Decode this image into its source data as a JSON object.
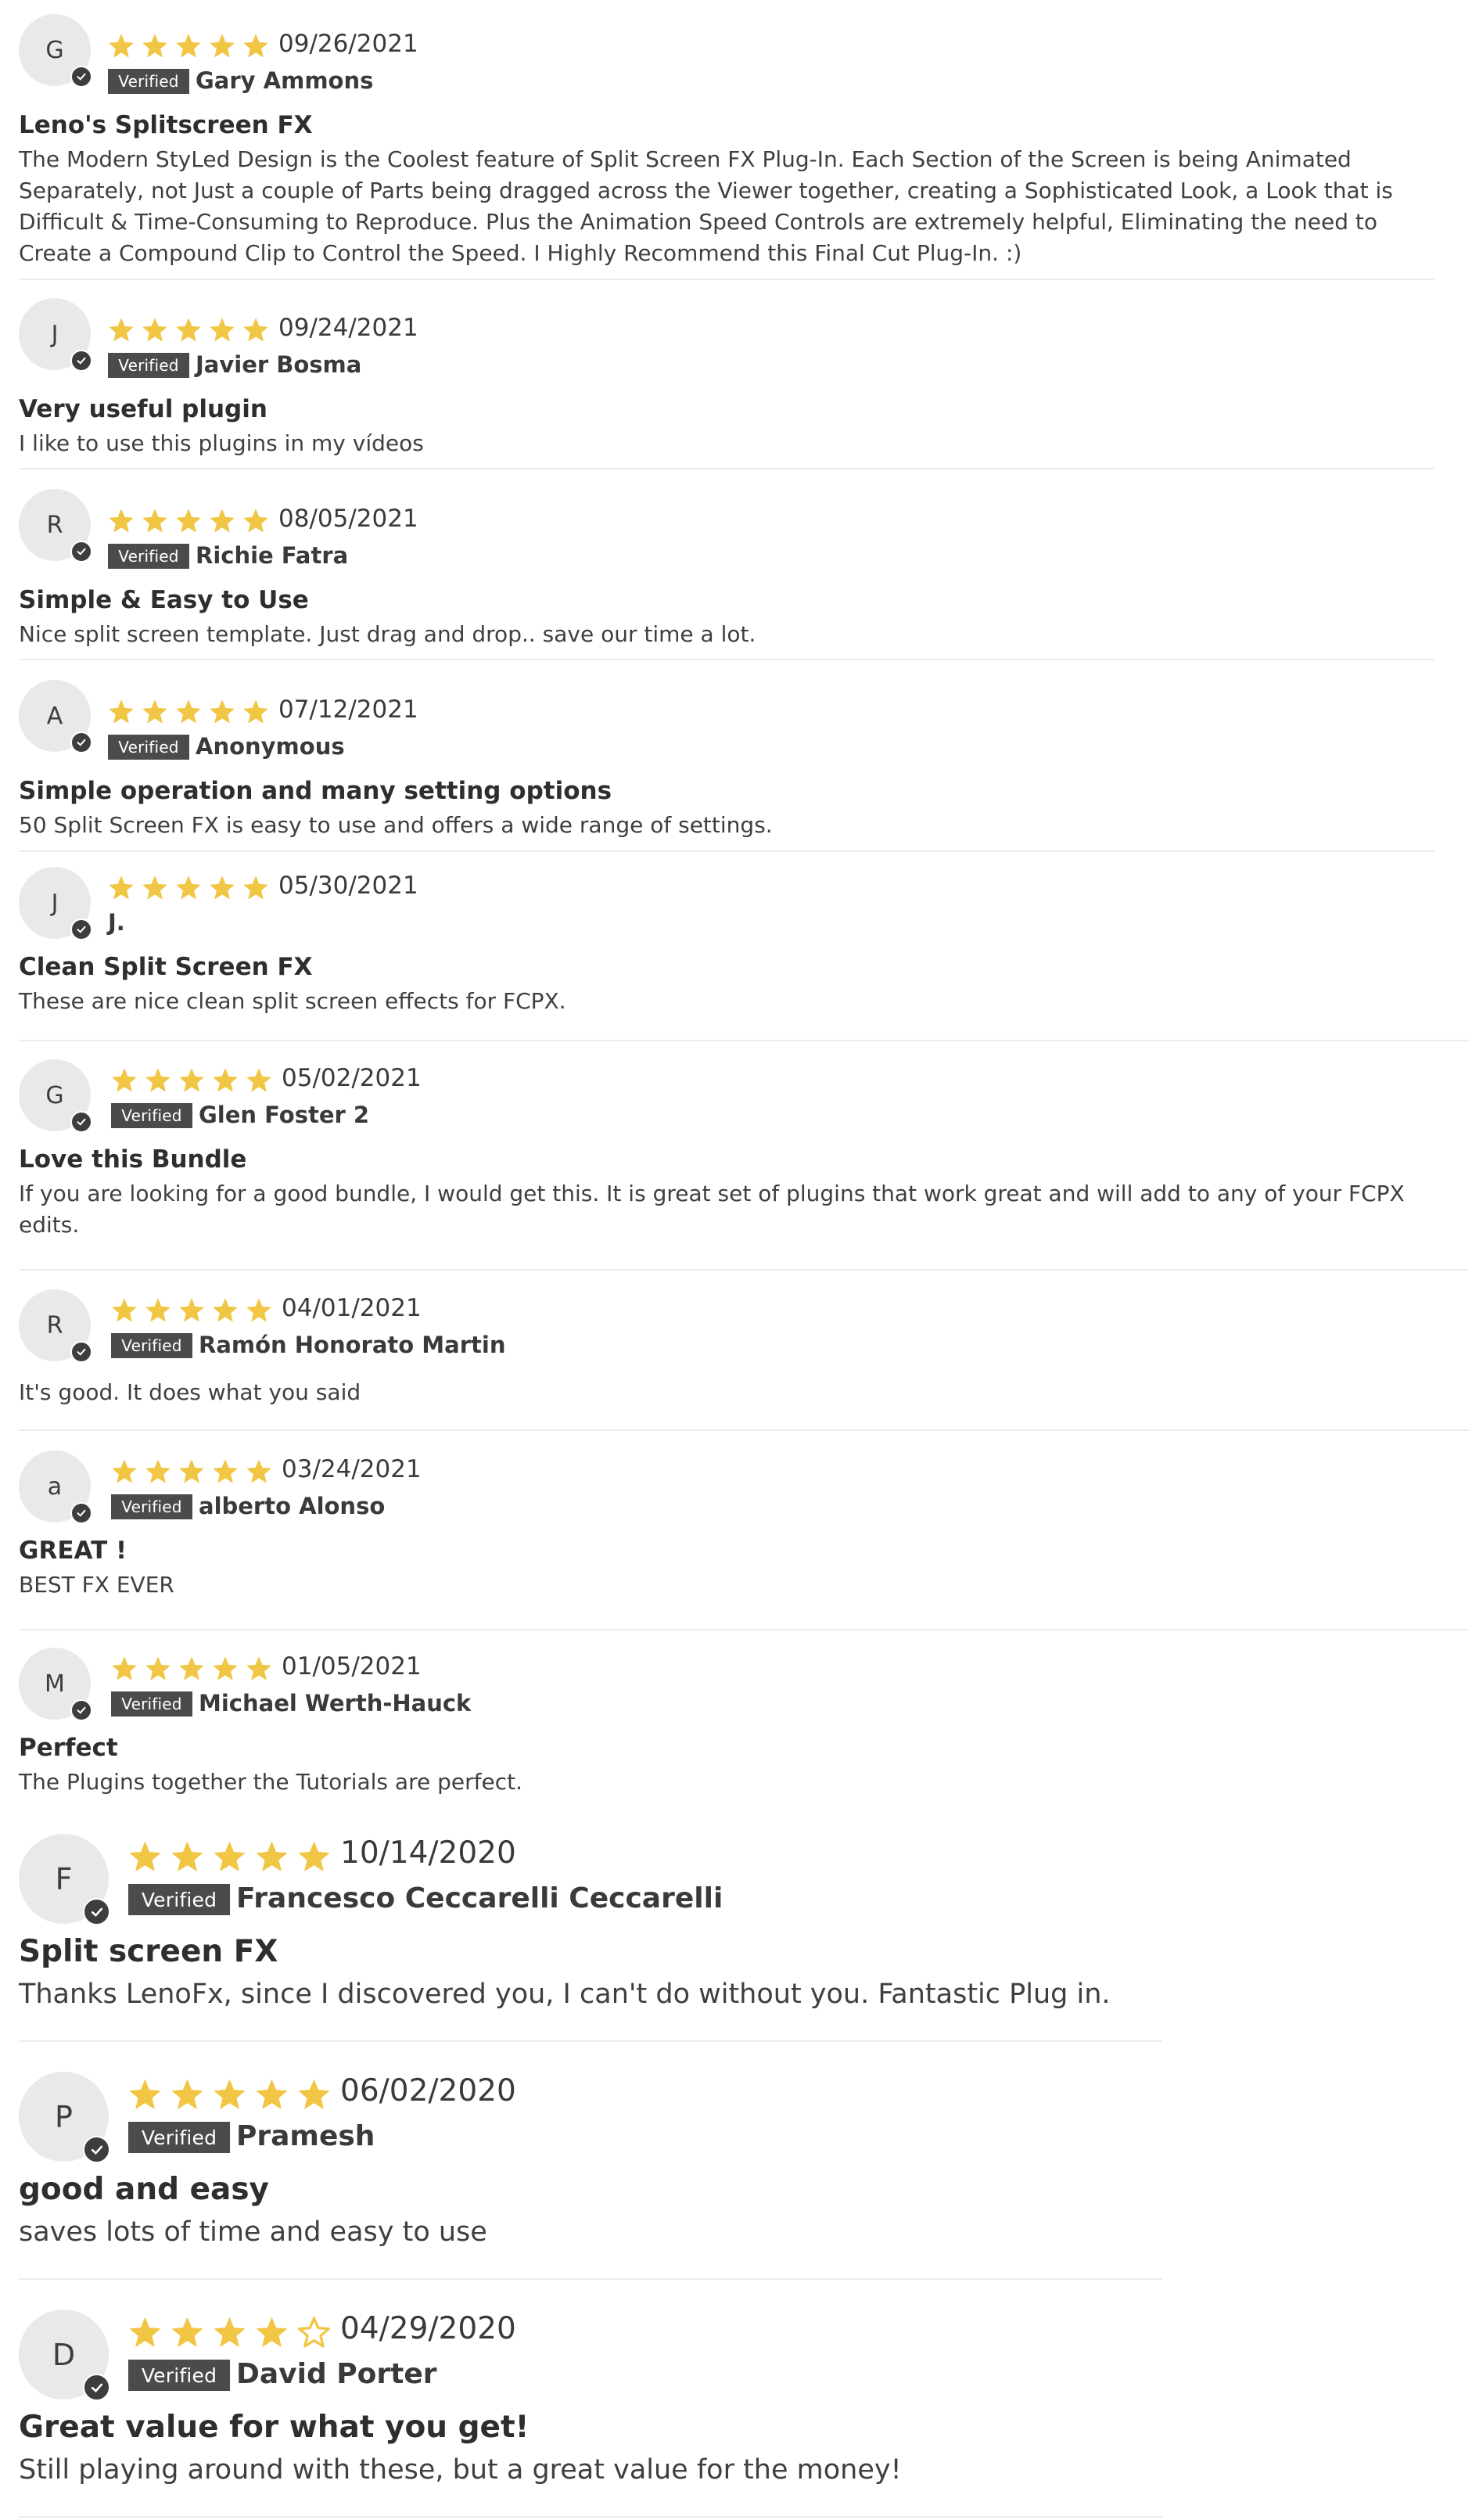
{
  "star_color": "#f1c644",
  "reviews": [
    {
      "initial": "G",
      "rating": 5,
      "date": "09/26/2021",
      "verified_label": "Verified",
      "author": "Gary Ammons",
      "title": "Leno's Splitscreen FX",
      "body": "The Modern StyLed Design is the Coolest feature of Split Screen FX Plug-In. Each Section of the Screen is being Animated Separately, not Just a couple of Parts being dragged across the Viewer together, creating a Sophisticated Look, a Look that is Difficult & Time-Consuming to Reproduce. Plus the Animation Speed Controls are extremely helpful, Eliminating the need to Create a Compound Clip to Control the Speed. I Highly Recommend this Final Cut Plug-In. :)"
    },
    {
      "initial": "J",
      "rating": 5,
      "date": "09/24/2021",
      "verified_label": "Verified",
      "author": "Javier Bosma",
      "title": "Very useful plugin",
      "body": "I like to use this plugins in my vídeos"
    },
    {
      "initial": "R",
      "rating": 5,
      "date": "08/05/2021",
      "verified_label": "Verified",
      "author": "Richie Fatra",
      "title": "Simple & Easy to Use",
      "body": "Nice split screen template. Just drag and drop.. save our time a lot."
    },
    {
      "initial": "A",
      "rating": 5,
      "date": "07/12/2021",
      "verified_label": "Verified",
      "author": "Anonymous",
      "title": "Simple operation and many setting options",
      "body": "50 Split Screen FX is easy to use and offers a wide range of settings."
    },
    {
      "initial": "J",
      "rating": 5,
      "date": "05/30/2021",
      "verified_label": "",
      "author": "J.",
      "title": "Clean Split Screen FX",
      "body": "These are nice clean split screen effects for FCPX."
    },
    {
      "initial": "G",
      "rating": 5,
      "date": "05/02/2021",
      "verified_label": "Verified",
      "author": "Glen Foster 2",
      "title": "Love this Bundle",
      "body": "If you are looking for a good bundle, I would get this. It is great set of plugins that work great and will add to any of your FCPX edits."
    },
    {
      "initial": "R",
      "rating": 5,
      "date": "04/01/2021",
      "verified_label": "Verified",
      "author": "Ramón Honorato Martin",
      "title": "",
      "body": "It's good. It does what you said"
    },
    {
      "initial": "a",
      "rating": 5,
      "date": "03/24/2021",
      "verified_label": "Verified",
      "author": "alberto Alonso",
      "title": "GREAT !",
      "body": "BEST FX EVER"
    },
    {
      "initial": "M",
      "rating": 5,
      "date": "01/05/2021",
      "verified_label": "Verified",
      "author": "Michael Werth-Hauck",
      "title": "Perfect",
      "body": "The Plugins together the Tutorials are perfect."
    },
    {
      "initial": "F",
      "rating": 5,
      "date": "10/14/2020",
      "verified_label": "Verified",
      "author": "Francesco Ceccarelli Ceccarelli",
      "title": "Split screen FX",
      "body": "Thanks LenoFx, since I discovered you, I can't do without you. Fantastic Plug in."
    },
    {
      "initial": "P",
      "rating": 5,
      "date": "06/02/2020",
      "verified_label": "Verified",
      "author": "Pramesh",
      "title": "good and easy",
      "body": "saves lots of time and easy to use"
    },
    {
      "initial": "D",
      "rating": 4,
      "date": "04/29/2020",
      "verified_label": "Verified",
      "author": "David Porter",
      "title": "Great value for what you get!",
      "body": "Still playing around with these, but a great value for the money!"
    }
  ]
}
